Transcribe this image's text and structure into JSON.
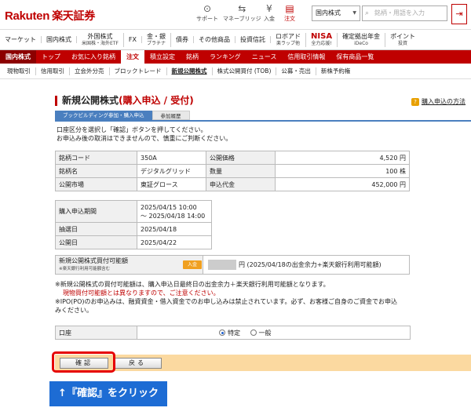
{
  "header": {
    "logo_en": "Rakuten",
    "logo_jp": "楽天証券",
    "icons": [
      {
        "name": "support-icon",
        "glyph": "⊙",
        "label": "サポート"
      },
      {
        "name": "money-bridge-icon",
        "glyph": "⇆",
        "label": "マネーブリッジ"
      },
      {
        "name": "deposit-icon",
        "glyph": "¥",
        "label": "入金"
      },
      {
        "name": "order-icon",
        "glyph": "▤",
        "label": "注文"
      }
    ],
    "search_scope": "国内株式",
    "search_placeholder": "銘柄・用語を入力",
    "logout_glyph": "⇥"
  },
  "product_nav": [
    {
      "label": "マーケット",
      "sub": ""
    },
    {
      "label": "国内株式",
      "sub": ""
    },
    {
      "label": "外国株式",
      "sub": "米国株・海外ETF"
    },
    {
      "label": "FX",
      "sub": ""
    },
    {
      "label": "金・銀",
      "sub": "プラチナ"
    },
    {
      "label": "債券",
      "sub": ""
    },
    {
      "label": "その他商品",
      "sub": ""
    },
    {
      "label": "投資信託",
      "sub": ""
    },
    {
      "label": "ロボアド",
      "sub": "楽ラップ他"
    },
    {
      "label": "NISA",
      "sub": "全力応援!"
    },
    {
      "label": "確定拠出年金",
      "sub": "iDeCo"
    },
    {
      "label": "ポイント",
      "sub": "投資"
    }
  ],
  "red_nav": [
    "国内株式",
    "トップ",
    "お気に入り銘柄",
    "注文",
    "積立設定",
    "銘柄",
    "ランキング",
    "ニュース",
    "信用取引情報",
    "保有商品一覧"
  ],
  "sub_nav": [
    "現物取引",
    "信用取引",
    "立会外分売",
    "ブロックトレード",
    "新規公開株式",
    "株式公開買付 (TOB)",
    "公募・売出",
    "新株予約権"
  ],
  "page": {
    "title": "新規公開株式",
    "title_sub": "(購入申込 / 受付)",
    "help_link": "購入申込の方法",
    "help_glyph": "?",
    "tab_active": "ブックビルディング参加・購入申込",
    "tab_inactive": "参加履歴",
    "instructions": [
      "口座区分を選択し「確認」ボタンを押してください。",
      "お申込み後の取消はできませんので、慎重にご判断ください。"
    ]
  },
  "stock_info": {
    "code_label": "銘柄コード",
    "code_value": "350A",
    "price_label": "公開価格",
    "price_value": "4,520 円",
    "name_label": "銘柄名",
    "name_value": "デジタルグリッド",
    "qty_label": "数量",
    "qty_value": "100 株",
    "market_label": "公開市場",
    "market_value": "東証グロース",
    "amount_label": "申込代金",
    "amount_value": "452,000 円"
  },
  "schedule": {
    "period_label": "購入申込期間",
    "period_value_1": "2025/04/15 10:00",
    "period_value_2": "～ 2025/04/18 14:00",
    "lottery_label": "抽選日",
    "lottery_value": "2025/04/18",
    "listing_label": "公開日",
    "listing_value": "2025/04/22"
  },
  "buying_power": {
    "label": "新規公開株式買付可能額",
    "note": "※楽天銀行利用可能額含む",
    "deposit_button": "入金",
    "text": "円 (2025/04/18の出金余力+楽天銀行利用可能額)"
  },
  "notes": [
    "※新規公開株式の買付可能額は、購入申込日最終日の出金余力＋楽天銀行利用可能額となります。",
    "現物買付可能額とは異なりますので、ご注意ください。",
    "※IPO(PO)のお申込みは、融資資金・借入資金でのお申し込みは禁止されています。必ず、お客様ご自身のご資金でお申込",
    "みください。"
  ],
  "account": {
    "label": "口座",
    "options": [
      "特定",
      "一般"
    ],
    "selected": "特定"
  },
  "buttons": {
    "confirm": "確認",
    "back": "戻る"
  },
  "callout": "↑『確認』をクリック",
  "colors": {
    "brand_red": "#bf0000",
    "tab_blue": "#4a7fbf",
    "button_bar": "#fbd9a0",
    "highlight": "#e60000",
    "callout_blue": "#1d6cd4"
  }
}
